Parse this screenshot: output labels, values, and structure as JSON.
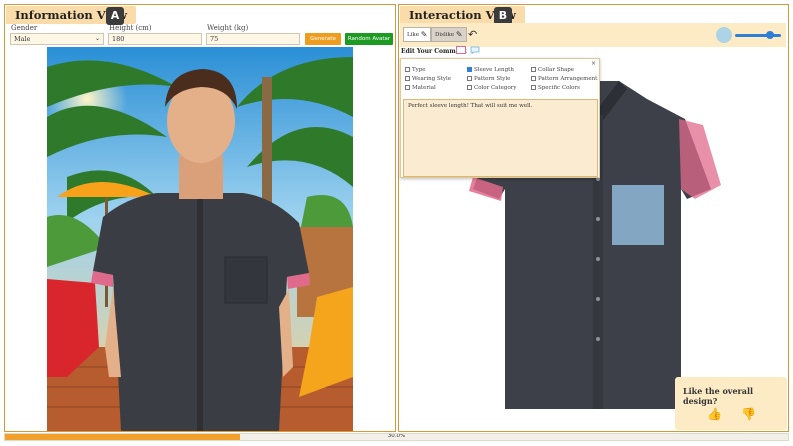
{
  "left_panel": {
    "title": "Information View",
    "badge": "A",
    "gender": {
      "label": "Gender",
      "value": "Male"
    },
    "height": {
      "label": "Height (cm)",
      "value": "180"
    },
    "weight": {
      "label": "Weight (kg)",
      "value": "75"
    },
    "generate_button": "Generate",
    "random_avatar_button": "Random Avatar"
  },
  "right_panel": {
    "title": "Interaction View",
    "badge": "B",
    "like_button": "Like",
    "dislike_button": "Dislike",
    "edit_label": "Edit Your Comment",
    "brush_size_level": 0.75,
    "comment_popup": {
      "close": "×",
      "options": [
        {
          "label": "Type",
          "checked": false
        },
        {
          "label": "Sleeve Length",
          "checked": true
        },
        {
          "label": "Collar Shape",
          "checked": false
        },
        {
          "label": "Wearing Style",
          "checked": false
        },
        {
          "label": "Pattern Style",
          "checked": false
        },
        {
          "label": "Pattern Arrangement",
          "checked": false
        },
        {
          "label": "Material",
          "checked": false
        },
        {
          "label": "Color Category",
          "checked": false
        },
        {
          "label": "Specific Colors",
          "checked": false
        }
      ],
      "comment": "Perfect sleeve length! That will suit me well."
    },
    "feedback": {
      "title": "Like the overall design?",
      "like_icon": "thumbs-up-icon",
      "dislike_icon": "thumbs-down-icon"
    }
  },
  "progress": {
    "value": 0.3,
    "label": "30.0%"
  },
  "colors": {
    "accent": "#f0a02b",
    "panel_border": "#d49a3a",
    "title_bg": "#f9dcaa",
    "generate": "#ef9d1f",
    "random": "#1c9a22",
    "highlight_pink": "#e06a8c",
    "highlight_blue": "#8fb8d9"
  }
}
